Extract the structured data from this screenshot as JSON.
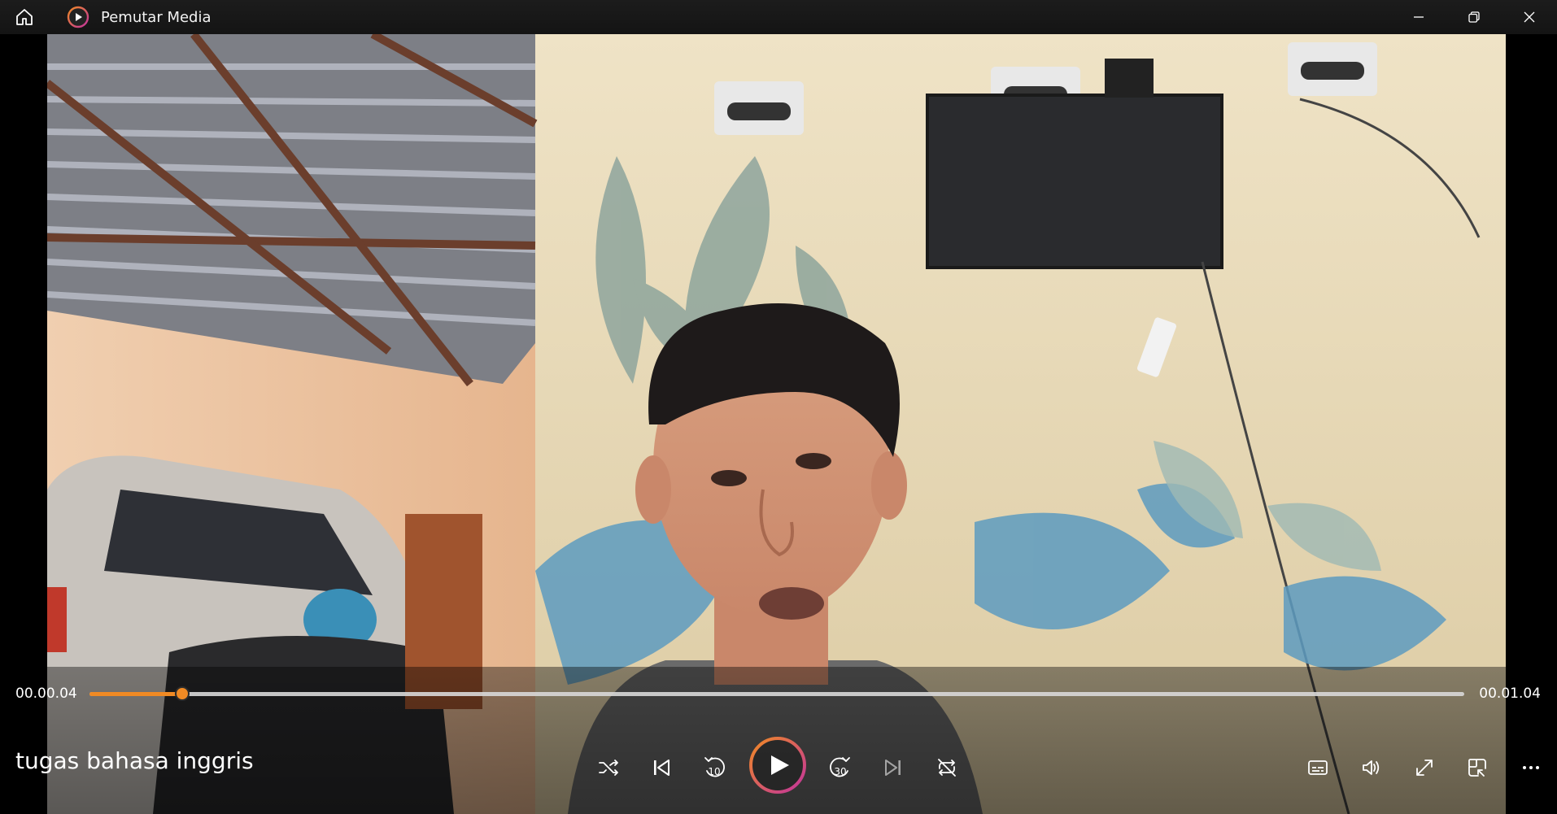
{
  "window": {
    "title": "Pemutar Media",
    "home_icon": "home-icon",
    "app_icon": "media-player-icon",
    "controls": [
      "minimize-icon",
      "restore-icon",
      "close-icon"
    ]
  },
  "player": {
    "current_time": "00.00.04",
    "duration": "00.01.04",
    "progress": 0.0675,
    "media_title": "tugas bahasa inggris",
    "accent_color": "#f08a24",
    "play_ring_gradient": [
      "#f08a24",
      "#c2339c"
    ],
    "controls": {
      "shuffle": "shuffle-icon",
      "previous": "previous-icon",
      "skip_back": {
        "icon": "skip-back-icon",
        "label": "10"
      },
      "play": "play-icon",
      "skip_forward": {
        "icon": "skip-forward-icon",
        "label": "30"
      },
      "next": "next-icon",
      "repeat": "repeat-off-icon",
      "captions": "captions-icon",
      "volume": "volume-icon",
      "fullscreen": "fullscreen-icon",
      "mini_player": "mini-player-icon",
      "more": "more-icon"
    }
  }
}
